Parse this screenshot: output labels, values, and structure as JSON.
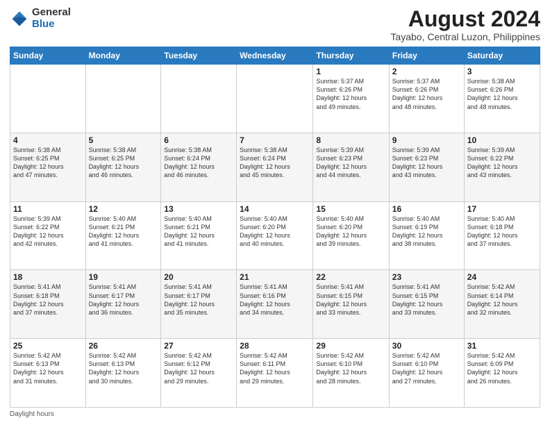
{
  "header": {
    "logo_general": "General",
    "logo_blue": "Blue",
    "month_year": "August 2024",
    "location": "Tayabo, Central Luzon, Philippines"
  },
  "days_of_week": [
    "Sunday",
    "Monday",
    "Tuesday",
    "Wednesday",
    "Thursday",
    "Friday",
    "Saturday"
  ],
  "weeks": [
    [
      {
        "day": "",
        "info": ""
      },
      {
        "day": "",
        "info": ""
      },
      {
        "day": "",
        "info": ""
      },
      {
        "day": "",
        "info": ""
      },
      {
        "day": "1",
        "info": "Sunrise: 5:37 AM\nSunset: 6:26 PM\nDaylight: 12 hours\nand 49 minutes."
      },
      {
        "day": "2",
        "info": "Sunrise: 5:37 AM\nSunset: 6:26 PM\nDaylight: 12 hours\nand 48 minutes."
      },
      {
        "day": "3",
        "info": "Sunrise: 5:38 AM\nSunset: 6:26 PM\nDaylight: 12 hours\nand 48 minutes."
      }
    ],
    [
      {
        "day": "4",
        "info": "Sunrise: 5:38 AM\nSunset: 6:25 PM\nDaylight: 12 hours\nand 47 minutes."
      },
      {
        "day": "5",
        "info": "Sunrise: 5:38 AM\nSunset: 6:25 PM\nDaylight: 12 hours\nand 46 minutes."
      },
      {
        "day": "6",
        "info": "Sunrise: 5:38 AM\nSunset: 6:24 PM\nDaylight: 12 hours\nand 46 minutes."
      },
      {
        "day": "7",
        "info": "Sunrise: 5:38 AM\nSunset: 6:24 PM\nDaylight: 12 hours\nand 45 minutes."
      },
      {
        "day": "8",
        "info": "Sunrise: 5:39 AM\nSunset: 6:23 PM\nDaylight: 12 hours\nand 44 minutes."
      },
      {
        "day": "9",
        "info": "Sunrise: 5:39 AM\nSunset: 6:23 PM\nDaylight: 12 hours\nand 43 minutes."
      },
      {
        "day": "10",
        "info": "Sunrise: 5:39 AM\nSunset: 6:22 PM\nDaylight: 12 hours\nand 43 minutes."
      }
    ],
    [
      {
        "day": "11",
        "info": "Sunrise: 5:39 AM\nSunset: 6:22 PM\nDaylight: 12 hours\nand 42 minutes."
      },
      {
        "day": "12",
        "info": "Sunrise: 5:40 AM\nSunset: 6:21 PM\nDaylight: 12 hours\nand 41 minutes."
      },
      {
        "day": "13",
        "info": "Sunrise: 5:40 AM\nSunset: 6:21 PM\nDaylight: 12 hours\nand 41 minutes."
      },
      {
        "day": "14",
        "info": "Sunrise: 5:40 AM\nSunset: 6:20 PM\nDaylight: 12 hours\nand 40 minutes."
      },
      {
        "day": "15",
        "info": "Sunrise: 5:40 AM\nSunset: 6:20 PM\nDaylight: 12 hours\nand 39 minutes."
      },
      {
        "day": "16",
        "info": "Sunrise: 5:40 AM\nSunset: 6:19 PM\nDaylight: 12 hours\nand 38 minutes."
      },
      {
        "day": "17",
        "info": "Sunrise: 5:40 AM\nSunset: 6:18 PM\nDaylight: 12 hours\nand 37 minutes."
      }
    ],
    [
      {
        "day": "18",
        "info": "Sunrise: 5:41 AM\nSunset: 6:18 PM\nDaylight: 12 hours\nand 37 minutes."
      },
      {
        "day": "19",
        "info": "Sunrise: 5:41 AM\nSunset: 6:17 PM\nDaylight: 12 hours\nand 36 minutes."
      },
      {
        "day": "20",
        "info": "Sunrise: 5:41 AM\nSunset: 6:17 PM\nDaylight: 12 hours\nand 35 minutes."
      },
      {
        "day": "21",
        "info": "Sunrise: 5:41 AM\nSunset: 6:16 PM\nDaylight: 12 hours\nand 34 minutes."
      },
      {
        "day": "22",
        "info": "Sunrise: 5:41 AM\nSunset: 6:15 PM\nDaylight: 12 hours\nand 33 minutes."
      },
      {
        "day": "23",
        "info": "Sunrise: 5:41 AM\nSunset: 6:15 PM\nDaylight: 12 hours\nand 33 minutes."
      },
      {
        "day": "24",
        "info": "Sunrise: 5:42 AM\nSunset: 6:14 PM\nDaylight: 12 hours\nand 32 minutes."
      }
    ],
    [
      {
        "day": "25",
        "info": "Sunrise: 5:42 AM\nSunset: 6:13 PM\nDaylight: 12 hours\nand 31 minutes."
      },
      {
        "day": "26",
        "info": "Sunrise: 5:42 AM\nSunset: 6:13 PM\nDaylight: 12 hours\nand 30 minutes."
      },
      {
        "day": "27",
        "info": "Sunrise: 5:42 AM\nSunset: 6:12 PM\nDaylight: 12 hours\nand 29 minutes."
      },
      {
        "day": "28",
        "info": "Sunrise: 5:42 AM\nSunset: 6:11 PM\nDaylight: 12 hours\nand 29 minutes."
      },
      {
        "day": "29",
        "info": "Sunrise: 5:42 AM\nSunset: 6:10 PM\nDaylight: 12 hours\nand 28 minutes."
      },
      {
        "day": "30",
        "info": "Sunrise: 5:42 AM\nSunset: 6:10 PM\nDaylight: 12 hours\nand 27 minutes."
      },
      {
        "day": "31",
        "info": "Sunrise: 5:42 AM\nSunset: 6:09 PM\nDaylight: 12 hours\nand 26 minutes."
      }
    ]
  ],
  "footer": {
    "daylight_label": "Daylight hours"
  }
}
